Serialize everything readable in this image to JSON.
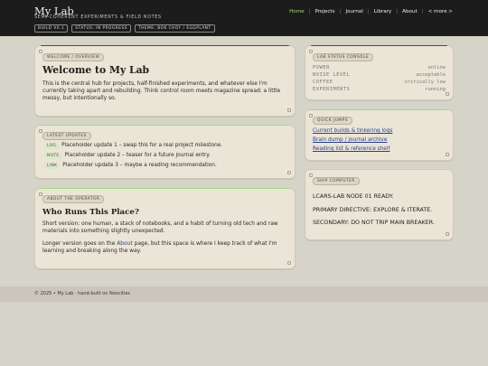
{
  "header": {
    "title": "My Lab",
    "tagline": "SEMI-COHERENT EXPERIMENTS & FIELD NOTES",
    "nav": [
      {
        "label": "Home",
        "active": true
      },
      {
        "label": "Projects"
      },
      {
        "label": "Journal"
      },
      {
        "label": "Library"
      },
      {
        "label": "About"
      },
      {
        "label": "< more >"
      }
    ],
    "pills": [
      "BUILD V0.1",
      "STATUS: IN PROGRESS",
      "THEME: BOK CHOY / EGGPLANT"
    ]
  },
  "welcome": {
    "tag": "WELCOME / OVERVIEW",
    "title": "Welcome to My Lab",
    "body": "This is the central hub for projects, half-finished experiments, and whatever else I'm currently taking apart and rebuilding. Think control room meets magazine spread: a little messy, but intentionally so."
  },
  "updates": {
    "tag": "LATEST UPDATES",
    "items": [
      {
        "badge": "LOG",
        "text": "Placeholder update 1 – swap this for a real project milestone."
      },
      {
        "badge": "NOTE",
        "text": "Placeholder update 2 – teaser for a future journal entry."
      },
      {
        "badge": "LINK",
        "text": "Placeholder update 3 – maybe a reading recommendation."
      }
    ]
  },
  "operator": {
    "tag": "ABOUT THE OPERATOR",
    "title": "Who Runs This Place?",
    "body1": "Short version: one human, a stack of notebooks, and a habit of turning old tech and raw materials into something slightly unexpected.",
    "body2_pre": "Longer version goes on the ",
    "body2_link": "About",
    "body2_post": " page, but this space is where I keep track of what I'm learning and breaking along the way."
  },
  "console": {
    "tag": "LAB STATUS CONSOLE",
    "rows": [
      {
        "key": "POWER",
        "value": "online"
      },
      {
        "key": "NOISE LEVEL",
        "value": "acceptable"
      },
      {
        "key": "COFFEE",
        "value": "critically low"
      },
      {
        "key": "EXPERIMENTS",
        "value": "running"
      }
    ]
  },
  "quick": {
    "tag": "QUICK JUMPS",
    "links": [
      "Current builds & tinkering logs",
      "Brain dump / journal archive",
      "Reading list & reference shelf"
    ]
  },
  "ship": {
    "tag": "SHIP COMPUTER",
    "lines": [
      "LCARS-LAB NODE 01 READY.",
      "PRIMARY DIRECTIVE: EXPLORE & ITERATE.",
      "SECONDARY: DO NOT TRIP MAIN BREAKER."
    ]
  },
  "footer": {
    "text": "© 2025 • My Lab  ·  hand-built on Neocities"
  },
  "colors": {
    "accent_green": "#a7d87c",
    "accent_purple": "#5b3f76",
    "link_blue": "#2c3f86"
  }
}
